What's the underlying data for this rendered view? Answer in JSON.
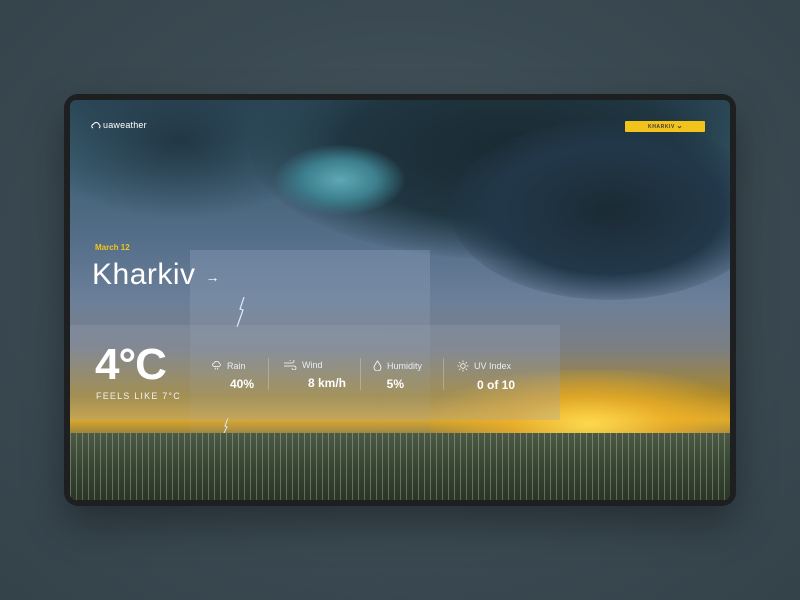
{
  "app": {
    "logo_text": "uaweather"
  },
  "header": {
    "city_button_label": "KHARKIV",
    "city_button_icon": "chevron-down-icon",
    "accent_color": "#f2c31a"
  },
  "location": {
    "date": "March 12",
    "city": "Kharkiv",
    "arrow": "→"
  },
  "current": {
    "temperature": "4°C",
    "feels_like": "FEELS LIKE 7°C"
  },
  "stats": [
    {
      "icon": "rain-cloud-icon",
      "label": "Rain",
      "value": "40%"
    },
    {
      "icon": "wind-icon",
      "label": "Wind",
      "value": "8 km/h"
    },
    {
      "icon": "humidity-drop-icon",
      "label": "Humidity",
      "value": "5%"
    },
    {
      "icon": "sun-icon",
      "label": "UV Index",
      "value": "0 of 10"
    }
  ]
}
